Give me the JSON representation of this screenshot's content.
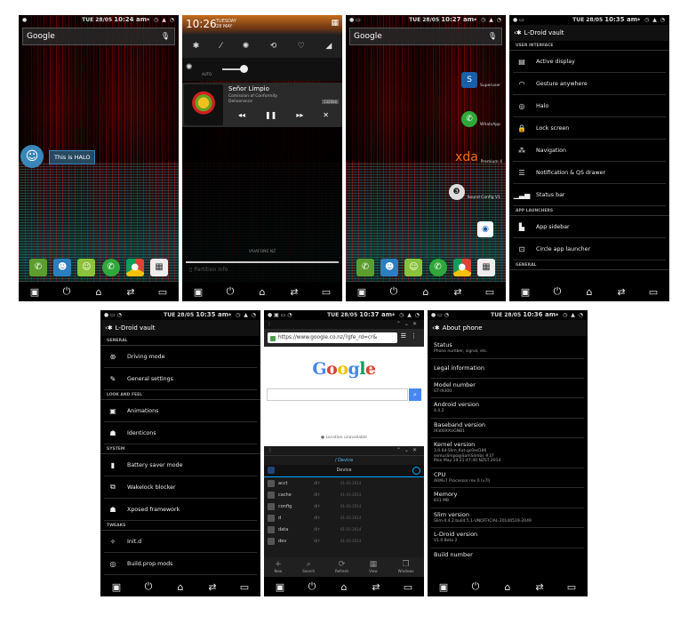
{
  "screens": {
    "home1": {
      "time_day": "TUE 28/05",
      "time": "10:24 am",
      "search_text": "Google",
      "halo_label": "This is HALO"
    },
    "notif": {
      "clock": "10:26",
      "date": "TUESDAY\n28 MAY",
      "track_title": "Señor Limpio",
      "track_album": "Comission of Conformity",
      "track_artist": "Deliverance",
      "track_tag": "1320kb",
      "brightness_auto": "AUTO",
      "carrier": "VIVAFONE NZ",
      "partition": "Partition info"
    },
    "home2": {
      "time_day": "TUE 28/05",
      "time": "10:27 am",
      "search_text": "Google",
      "shortcuts": [
        "Superuser",
        "WhatsApp",
        "Premium 4",
        "Sound Config V1",
        "Chrome"
      ],
      "xda_text": "xda"
    },
    "vault1": {
      "time_day": "TUE 28/05",
      "time": "10:35 am",
      "title": "L-Droid vault",
      "sections": [
        {
          "header": "USER INTERFACE",
          "items": [
            "Active display",
            "Gesture anywhere",
            "Halo",
            "Lock screen",
            "Navigation",
            "Notification & QS drawer",
            "Status bar"
          ]
        },
        {
          "header": "APP LAUNCHERS",
          "items": [
            "App sidebar",
            "Circle app launcher"
          ]
        },
        {
          "header": "GENERAL",
          "items": []
        }
      ]
    },
    "vault2": {
      "time_day": "TUE 28/05",
      "time": "10:35 am",
      "title": "L-Droid vault",
      "sections": [
        {
          "header": "GENERAL",
          "items": [
            "Driving mode",
            "General settings"
          ]
        },
        {
          "header": "LOOK AND FEEL",
          "items": [
            "Animations",
            "Identicons"
          ]
        },
        {
          "header": "SYSTEM",
          "items": [
            "Battery saver mode",
            "Wakelock blocker",
            "Xposed framework"
          ]
        },
        {
          "header": "TWEAKS",
          "items": [
            "Init.d",
            "Build.prop mods"
          ]
        }
      ]
    },
    "browser": {
      "time_day": "TUE 28/05",
      "time": "10:37 am",
      "url": "https://www.google.co.nz/?gfe_rd=cr&",
      "location": "Location unavailable",
      "fm_path": "Device",
      "fm_crumb": "/ Device",
      "files": [
        {
          "name": "acct",
          "kind": "dir",
          "date": "01-01-2014"
        },
        {
          "name": "cache",
          "kind": "dir",
          "date": "01-01-2014"
        },
        {
          "name": "config",
          "kind": "dir",
          "date": "01-01-2014"
        },
        {
          "name": "d",
          "kind": "dir",
          "date": "01-01-2014"
        },
        {
          "name": "data",
          "kind": "dir",
          "date": "01-01-2014"
        },
        {
          "name": "dev",
          "kind": "dir",
          "date": "01-01-2014"
        }
      ],
      "fm_actions": [
        "New",
        "Search",
        "Refresh",
        "View",
        "Windows"
      ]
    },
    "about": {
      "time_day": "TUE 28/05",
      "time": "10:36 am",
      "title": "About phone",
      "items": [
        {
          "title": "Status",
          "value": "Phone number, signal, etc."
        },
        {
          "title": "Legal information",
          "value": ""
        },
        {
          "title": "Model number",
          "value": "GT-I9300"
        },
        {
          "title": "Android version",
          "value": "4.4.2"
        },
        {
          "title": "Baseband version",
          "value": "I9300XXUGNB1"
        },
        {
          "title": "Kernel version",
          "value": "3.0.64-Slim_Kat-gc0ed186\nsemuslimpo@SamSlimbs #37\nMon May 19 21:47:40 NZST 2014"
        },
        {
          "title": "CPU",
          "value": "ARMv7 Processor rev 0 (v7l)"
        },
        {
          "title": "Memory",
          "value": "831 MB"
        },
        {
          "title": "Slim version",
          "value": "Slim-4.4.2.build.5.1-UNOFFICIAL-20140519-2049"
        },
        {
          "title": "L-Droid version",
          "value": "V1.0 Beta 2"
        },
        {
          "title": "Build number",
          "value": ""
        }
      ]
    }
  },
  "nav_icons": [
    "recent-apps-icon",
    "power-icon",
    "home-icon",
    "switch-icon",
    "back-icon"
  ]
}
